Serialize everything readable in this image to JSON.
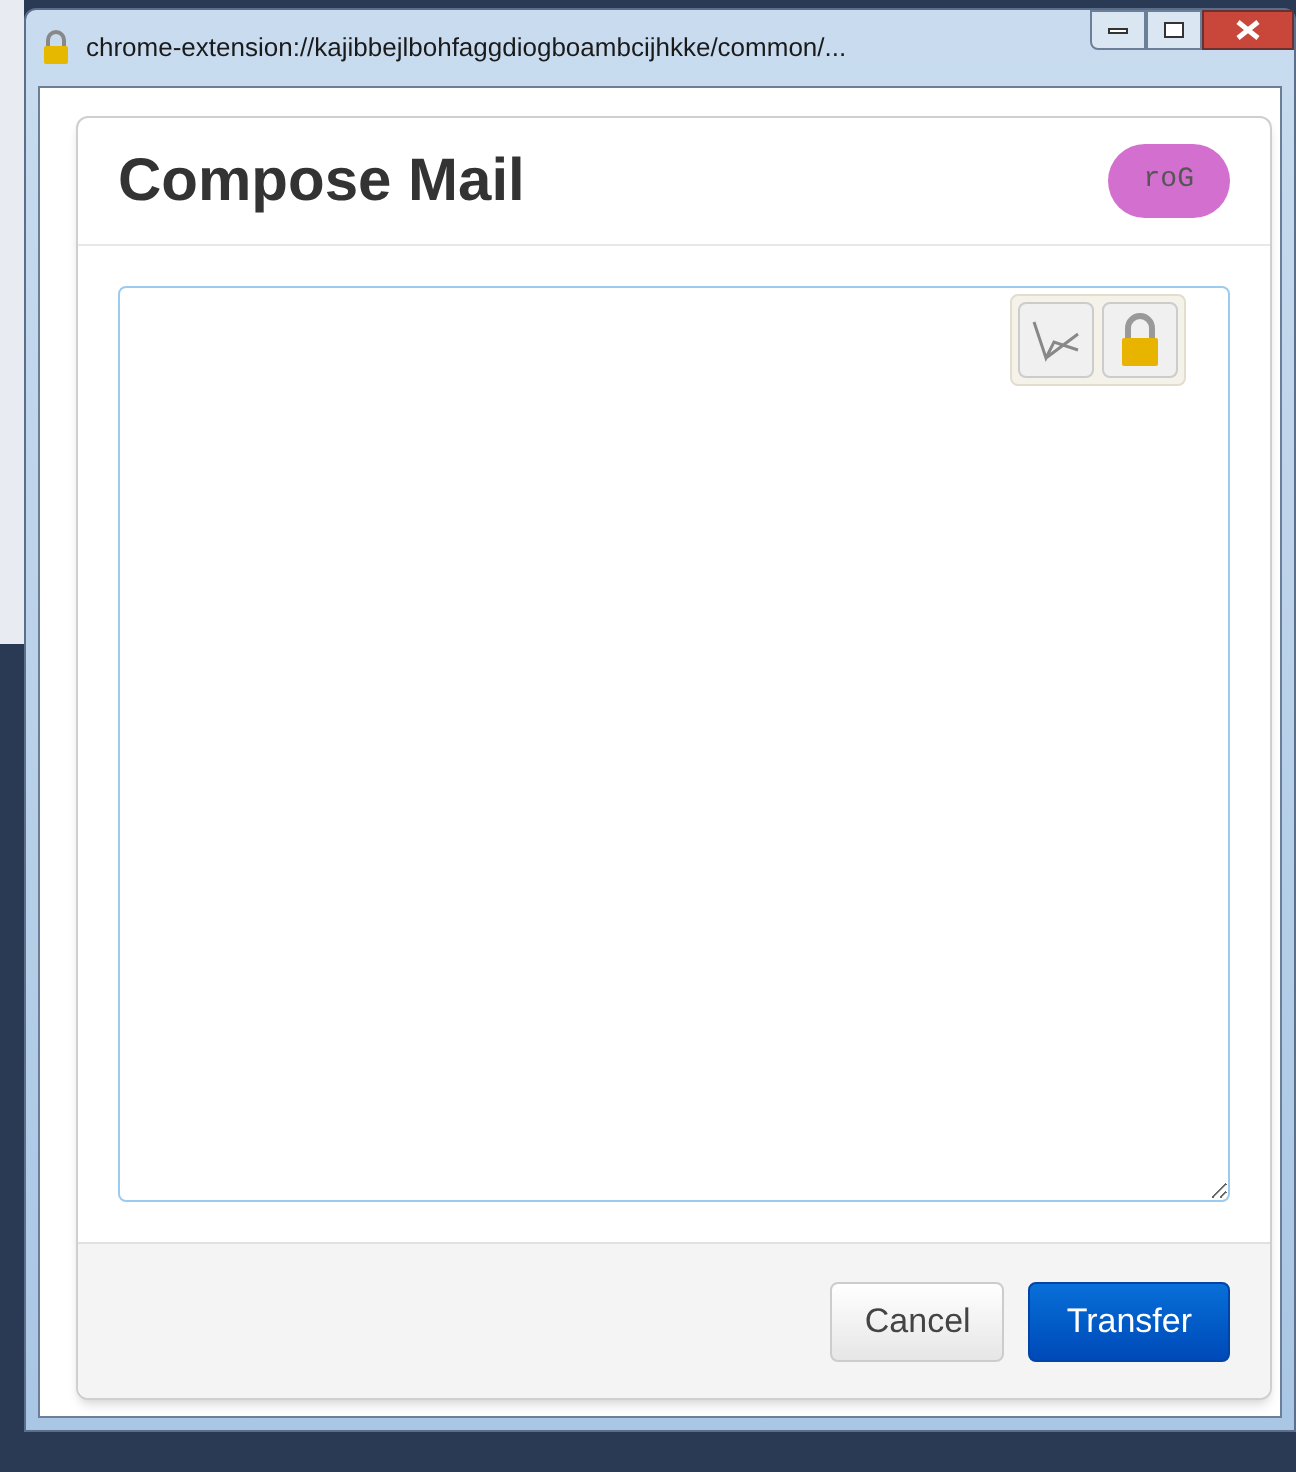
{
  "window": {
    "title": "chrome-extension://kajibbejlbohfaggdiogboambcijhkke/common/..."
  },
  "dialog": {
    "title": "Compose Mail",
    "badge": "roG"
  },
  "buttons": [
    {
      "label": "Cancel",
      "kind": "secondary"
    },
    {
      "label": "Transfer",
      "kind": "primary"
    }
  ]
}
